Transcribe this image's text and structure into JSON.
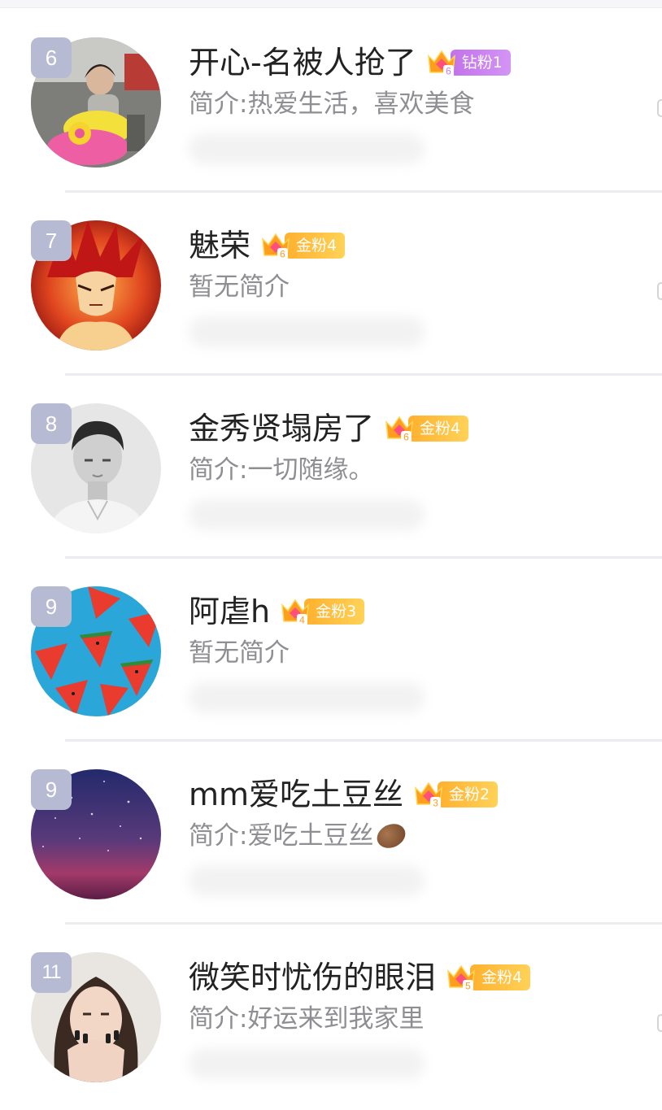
{
  "colors": {
    "rank_bg": "#b7bad3",
    "gold_pill": "#ffbb3d",
    "diamond_pill": "#c97cee",
    "name_text": "#222222",
    "intro_text": "#8e8e93"
  },
  "rows": [
    {
      "rank": "6",
      "name": "开心-名被人抢了",
      "badge": {
        "level": "6",
        "label": "钻粉1",
        "tier": "diamond"
      },
      "intro": "简介:热爱生活，喜欢美食",
      "avatar": "child-on-toy-car-photo"
    },
    {
      "rank": "7",
      "name": "魅荣",
      "badge": {
        "level": "6",
        "label": "金粉4",
        "tier": "gold"
      },
      "intro": "暂无简介",
      "avatar": "red-hair-anime-character"
    },
    {
      "rank": "8",
      "name": "金秀贤塌房了",
      "badge": {
        "level": "6",
        "label": "金粉4",
        "tier": "gold"
      },
      "intro": "简介:一切随缘。",
      "avatar": "man-portrait-grayscale"
    },
    {
      "rank": "9",
      "name": "阿虐h",
      "badge": {
        "level": "4",
        "label": "金粉3",
        "tier": "gold"
      },
      "intro": "暂无简介",
      "avatar": "watermelon-slices-on-blue"
    },
    {
      "rank": "9",
      "name": "mm爱吃土豆丝",
      "badge": {
        "level": "3",
        "label": "金粉2",
        "tier": "gold"
      },
      "intro": "简介:爱吃土豆丝",
      "intro_icon": "potato-emoji",
      "avatar": "starry-night-sky"
    },
    {
      "rank": "11",
      "name": "微笑时忧伤的眼泪",
      "badge": {
        "level": "5",
        "label": "金粉4",
        "tier": "gold"
      },
      "intro": "简介:好运来到我家里",
      "avatar": "woman-hands-on-face"
    }
  ]
}
